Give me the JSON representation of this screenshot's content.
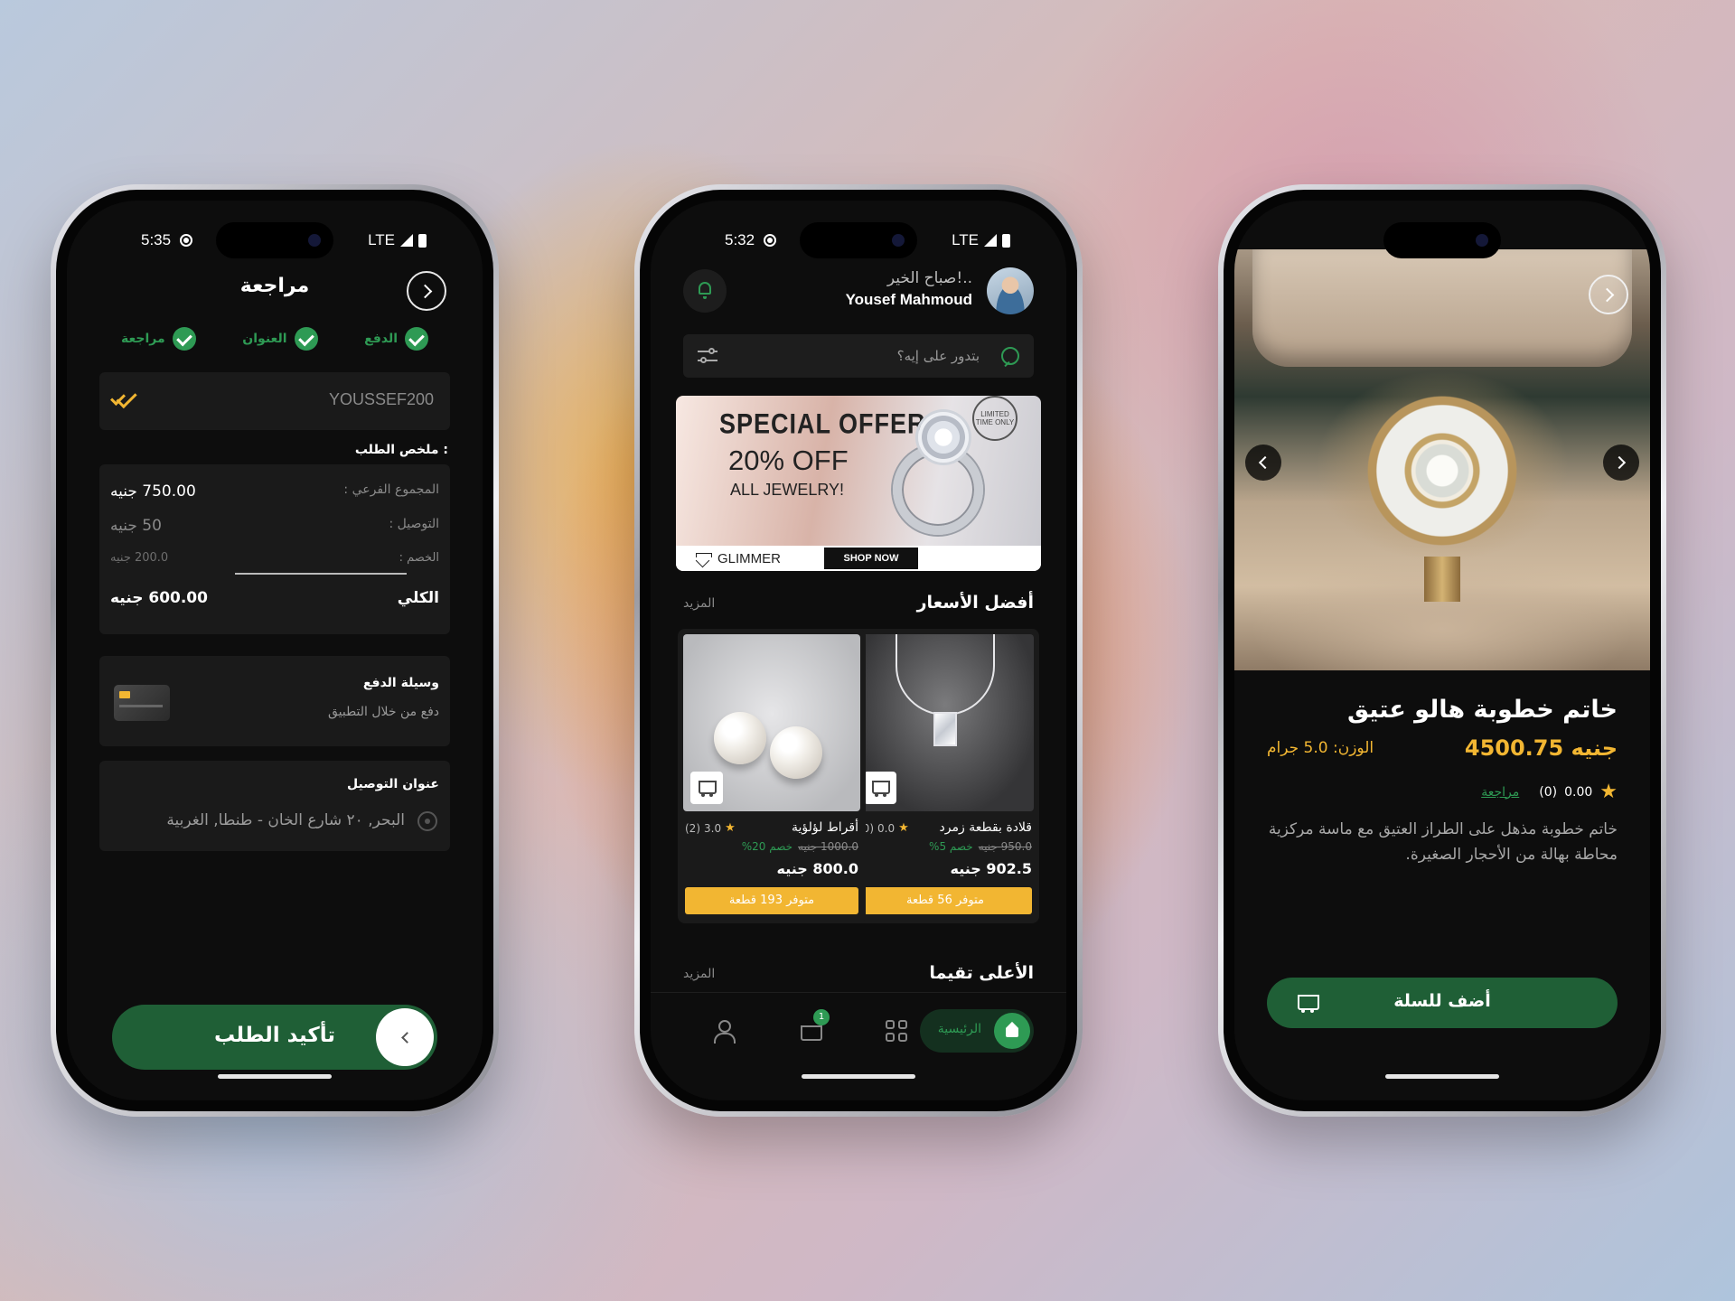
{
  "colors": {
    "brand_green": "#1f5f36",
    "accent_green": "#2e9a54",
    "accent_gold": "#f2b632",
    "screen_bg": "#0d0d0d",
    "card_bg": "#1a1a1a"
  },
  "review_screen": {
    "status": {
      "time": "5:35",
      "network": "LTE"
    },
    "header": {
      "title": "مراجعة",
      "back_icon": "chevron-right-icon"
    },
    "steps": [
      {
        "label": "الدفع",
        "icon": "check-circle-icon"
      },
      {
        "label": "العنوان",
        "icon": "check-circle-icon"
      },
      {
        "label": "مراجعة",
        "icon": "check-circle-icon"
      }
    ],
    "coupon": {
      "code": "YOUSSEF200",
      "icon": "double-check-icon"
    },
    "summary": {
      "title": "ملخص الطلب :",
      "subtotal_label": "المجموع الفرعي :",
      "subtotal_value": "750.00 جنيه",
      "delivery_label": "التوصيل :",
      "delivery_value": "50 جنيه",
      "discount_label": "الخصم :",
      "discount_value": "200.0 جنيه",
      "total_label": "الكلي",
      "total_value": "600.00 جنيه"
    },
    "payment": {
      "title": "وسيلة الدفع",
      "method": "دفع من خلال التطبيق",
      "icon": "credit-card-icon"
    },
    "address": {
      "title": "عنوان التوصيل",
      "value": "البحر, ٢٠ شارع الخان - طنطا, الغربية",
      "icon": "location-pin-icon"
    },
    "confirm_label": "تأكيد الطلب"
  },
  "home_screen": {
    "status": {
      "time": "5:32",
      "network": "LTE"
    },
    "greeting": "صباح الخير!..",
    "user_name": "Yousef Mahmoud",
    "search_placeholder": "بتدور على إيه؟",
    "banner": {
      "title": "SPECIAL OFFER",
      "discount": "20% OFF",
      "subtitle": "ALL JEWELRY!",
      "badge": "LIMITED TIME ONLY",
      "brand": "GLIMMER",
      "cta": "SHOP NOW"
    },
    "best_prices": {
      "title": "أفضل الأسعار",
      "more": "المزيد",
      "products": [
        {
          "name": "قلادة بقطعة زمرد",
          "rating": "0.0",
          "reviews": "(0)",
          "old_price": "950.0 جنيه",
          "discount": "خصم 5%",
          "price": "902.5 جنيه",
          "stock": "متوفر 56 قطعة"
        },
        {
          "name": "أقراط لؤلؤية",
          "rating": "3.0",
          "reviews": "(2)",
          "old_price": "1000.0 جنيه",
          "discount": "خصم 20%",
          "price": "800.0 جنيه",
          "stock": "متوفر 193 قطعة"
        }
      ]
    },
    "top_rated": {
      "title": "الأعلى تقيما",
      "more": "المزيد"
    },
    "nav": {
      "home_label": "الرئيسية",
      "cart_count": "1"
    }
  },
  "product_screen": {
    "title": "خاتم خطوبة هالو عتيق",
    "price": "4500.75 جنيه",
    "weight": "الوزن: 5.0 جرام",
    "rating": "0.00",
    "reviews_count": "(0)",
    "reviews_link": "مراجعة",
    "description": "خاتم خطوبة مذهل على الطراز العتيق مع ماسة مركزية محاطة بهالة من الأحجار الصغيرة.",
    "add_to_cart": "أضف للسلة"
  }
}
